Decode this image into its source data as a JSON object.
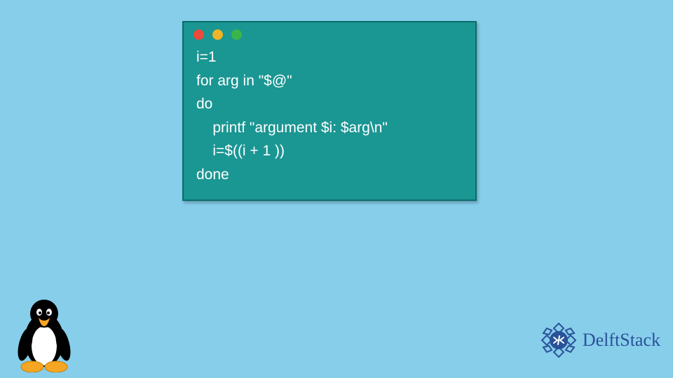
{
  "window": {
    "dots": [
      "#e94b3c",
      "#f0b429",
      "#3bb54a"
    ]
  },
  "code": {
    "lines": [
      "i=1",
      "for arg in \"$@\"",
      "do",
      "    printf \"argument $i: $arg\\n\"",
      "    i=$((i + 1 ))",
      "done"
    ]
  },
  "brand": {
    "name": "DelftStack"
  }
}
